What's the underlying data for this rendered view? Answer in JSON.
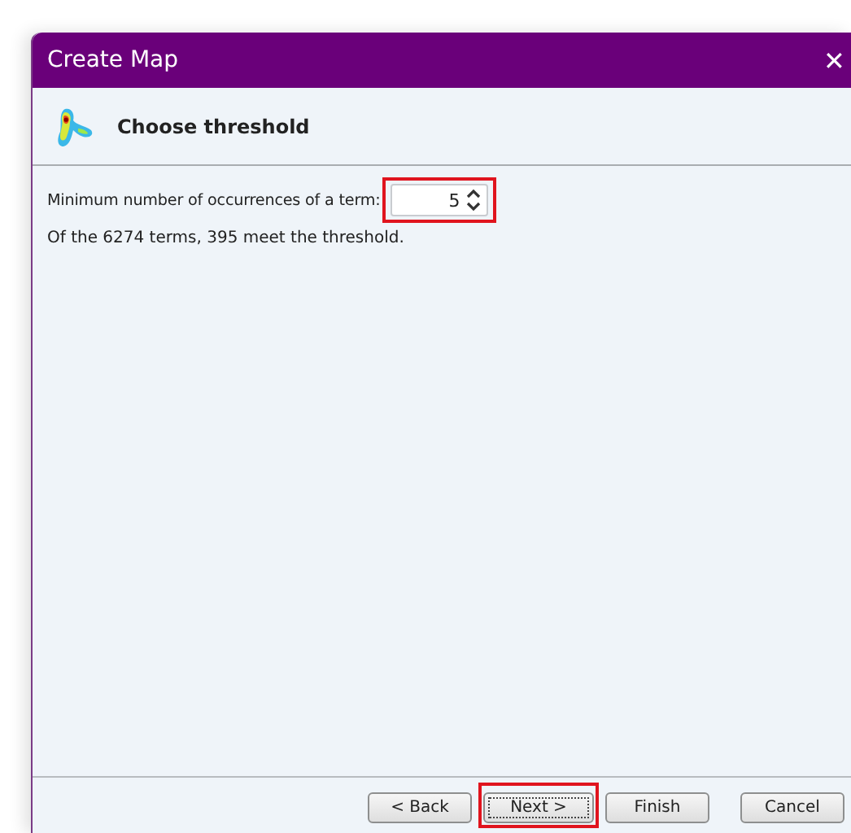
{
  "window": {
    "title": "Create Map",
    "close": "✕"
  },
  "header": {
    "title": "Choose threshold"
  },
  "threshold": {
    "label": "Minimum number of occurrences of a term:",
    "value": "5",
    "highlighted": true
  },
  "summary": "Of the 6274 terms, 395 meet the threshold.",
  "buttons": [
    {
      "label": "< Back",
      "focused": false,
      "highlighted": false
    },
    {
      "label": "Next >",
      "focused": true,
      "highlighted": true
    },
    {
      "label": "Finish",
      "focused": false,
      "highlighted": false
    },
    {
      "label": "Cancel",
      "focused": false,
      "highlighted": false
    }
  ]
}
